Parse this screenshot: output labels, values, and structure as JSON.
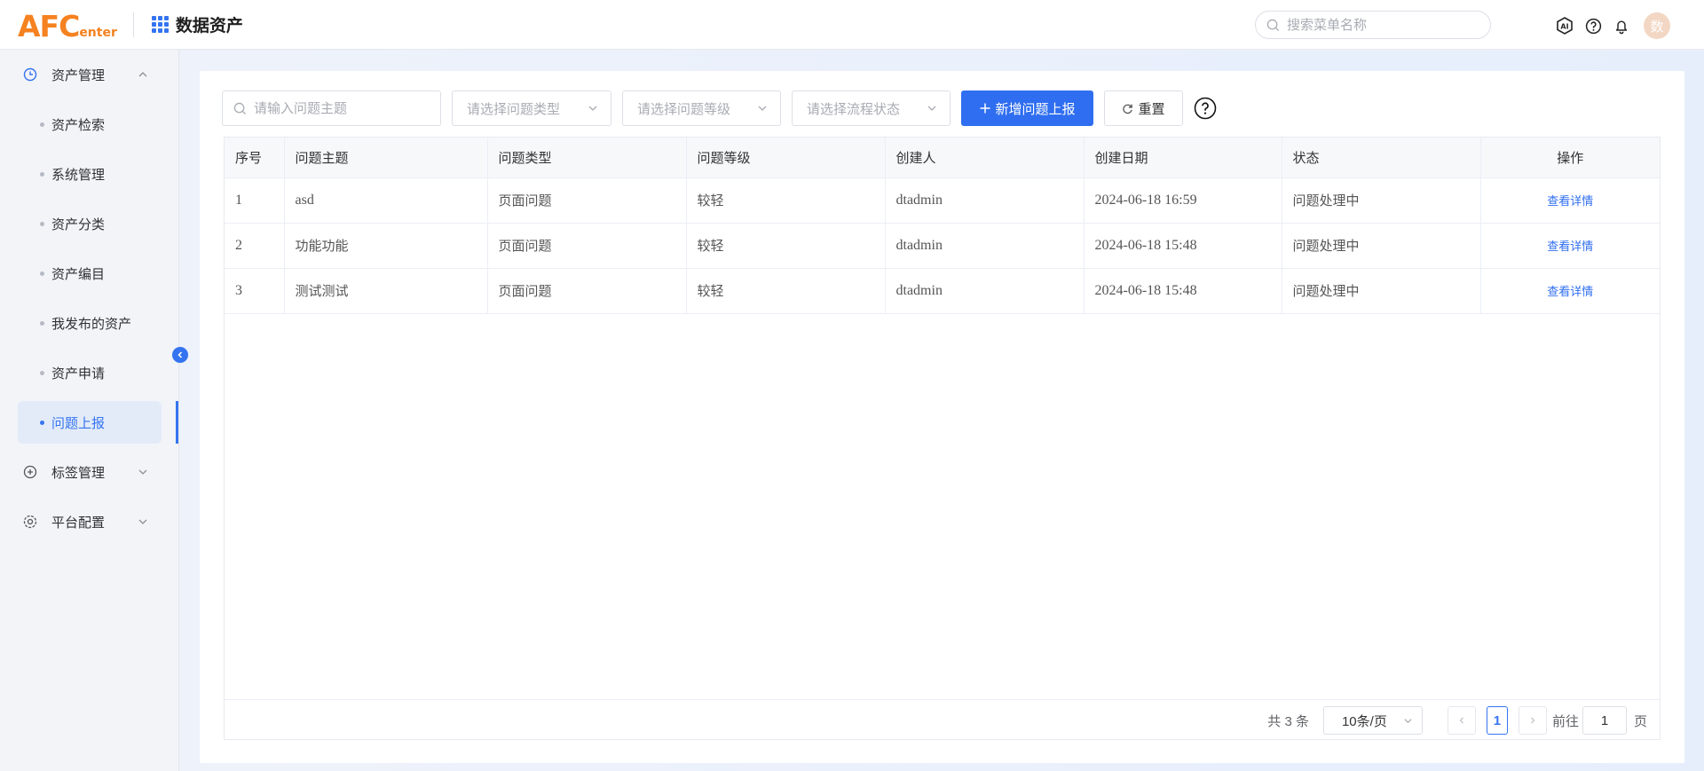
{
  "header": {
    "logo_big": "AFC",
    "logo_small": "enter",
    "app_title": "数据资产",
    "search_placeholder": "搜索菜单名称",
    "avatar_text": "数"
  },
  "sidebar": {
    "groups": [
      {
        "label": "资产管理",
        "expanded": true
      },
      {
        "label": "标签管理",
        "expanded": false
      },
      {
        "label": "平台配置",
        "expanded": false
      }
    ],
    "items": [
      {
        "label": "资产检索"
      },
      {
        "label": "系统管理"
      },
      {
        "label": "资产分类"
      },
      {
        "label": "资产编目"
      },
      {
        "label": "我发布的资产"
      },
      {
        "label": "资产申请"
      },
      {
        "label": "问题上报",
        "active": true
      }
    ]
  },
  "toolbar": {
    "subject_placeholder": "请输入问题主题",
    "type_placeholder": "请选择问题类型",
    "level_placeholder": "请选择问题等级",
    "status_placeholder": "请选择流程状态",
    "add_label": "新增问题上报",
    "reset_label": "重置"
  },
  "table": {
    "columns": [
      "序号",
      "问题主题",
      "问题类型",
      "问题等级",
      "创建人",
      "创建日期",
      "状态",
      "操作"
    ],
    "rows": [
      {
        "no": "1",
        "subject": "asd",
        "type": "页面问题",
        "level": "较轻",
        "creator": "dtadmin",
        "date": "2024-06-18 16:59",
        "status": "问题处理中",
        "action": "查看详情"
      },
      {
        "no": "2",
        "subject": "功能功能",
        "type": "页面问题",
        "level": "较轻",
        "creator": "dtadmin",
        "date": "2024-06-18 15:48",
        "status": "问题处理中",
        "action": "查看详情"
      },
      {
        "no": "3",
        "subject": "测试测试",
        "type": "页面问题",
        "level": "较轻",
        "creator": "dtadmin",
        "date": "2024-06-18 15:48",
        "status": "问题处理中",
        "action": "查看详情"
      }
    ]
  },
  "pagination": {
    "total_text": "共 3 条",
    "page_size": "10条/页",
    "current_page": "1",
    "goto_prefix": "前往",
    "goto_value": "1",
    "goto_suffix": "页"
  },
  "colors": {
    "primary": "#2f6ef0",
    "logo": "#f58220",
    "active_bg": "#e3ebf9"
  }
}
